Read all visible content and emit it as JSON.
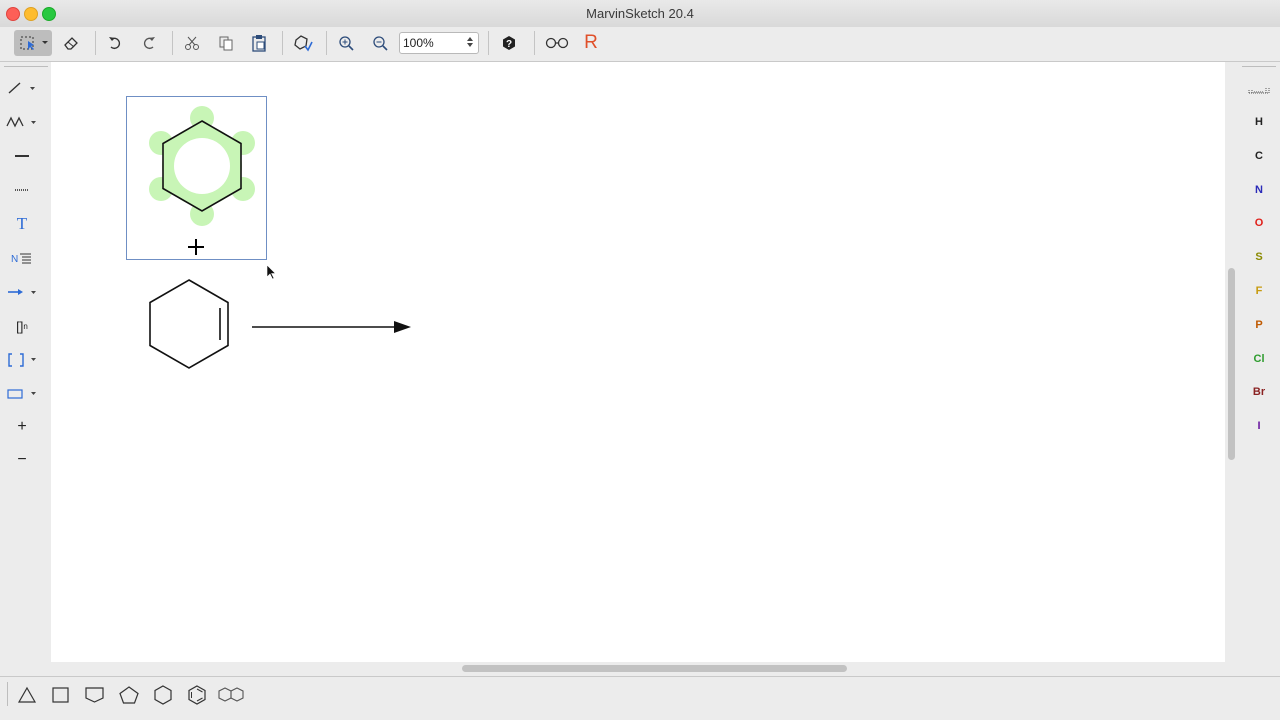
{
  "window": {
    "title": "MarvinSketch 20.4"
  },
  "toolbar": {
    "zoom_value": "100%",
    "buttons": [
      "select-tool",
      "erase",
      "undo",
      "redo",
      "cut",
      "copy",
      "paste",
      "clean",
      "zoom-in",
      "zoom-out",
      "help",
      "3d-view",
      "r-group"
    ],
    "r_label": "R"
  },
  "left_tools": {
    "text_label": "T",
    "bracket_label": "[]",
    "bracket_sub": "n",
    "plus_label": "+",
    "minus_label": "−"
  },
  "elements": [
    {
      "symbol": "H",
      "color": "#222222"
    },
    {
      "symbol": "C",
      "color": "#222222"
    },
    {
      "symbol": "N",
      "color": "#2a2ab8"
    },
    {
      "symbol": "O",
      "color": "#e0201a"
    },
    {
      "symbol": "S",
      "color": "#8a8a00"
    },
    {
      "symbol": "F",
      "color": "#c79b10"
    },
    {
      "symbol": "P",
      "color": "#c05a00"
    },
    {
      "symbol": "Cl",
      "color": "#2e9c2e"
    },
    {
      "symbol": "Br",
      "color": "#8a2222"
    },
    {
      "symbol": "I",
      "color": "#6a1aa0"
    }
  ],
  "colors": {
    "accent": "#2d6bd6",
    "selection_highlight": "#c8f5b6",
    "r_color": "#e0502a"
  }
}
